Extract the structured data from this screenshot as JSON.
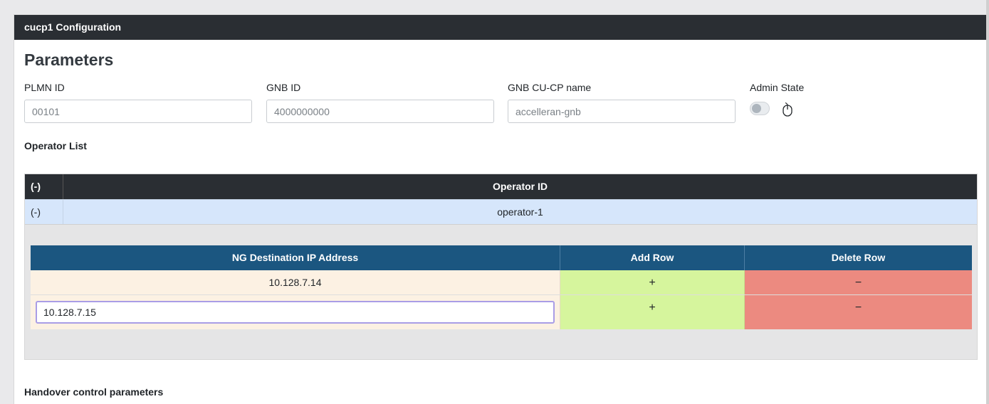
{
  "panel": {
    "title": "cucp1 Configuration"
  },
  "parameters": {
    "title": "Parameters",
    "fields": [
      {
        "label": "PLMN ID",
        "placeholder": "00101"
      },
      {
        "label": "GNB ID",
        "placeholder": "4000000000"
      },
      {
        "label": "GNB CU-CP name",
        "placeholder": "accelleran-gnb"
      }
    ],
    "admin_state": {
      "label": "Admin State",
      "enabled": false,
      "icon": "mouse-icon"
    }
  },
  "operator_list": {
    "label": "Operator List",
    "headers": {
      "toggle": "(-)",
      "operator_id": "Operator ID"
    },
    "rows": [
      {
        "toggle": "(-)",
        "operator_id": "operator-1"
      }
    ],
    "ng_table": {
      "headers": {
        "ip": "NG Destination IP Address",
        "add": "Add Row",
        "delete": "Delete Row"
      },
      "rows": [
        {
          "ip": "10.128.7.14",
          "add": "+",
          "delete": "−"
        }
      ],
      "editing_row": {
        "value": "10.128.7.15",
        "add": "+",
        "delete": "−"
      }
    }
  },
  "handover": {
    "label": "Handover control parameters"
  },
  "colors": {
    "header_dark": "#2a2e33",
    "ng_header": "#1b5680",
    "selected_row": "#d6e6fb",
    "ip_cell": "#fcf1e3",
    "add_cell": "#d6f59d",
    "delete_cell": "#ec8a80"
  }
}
